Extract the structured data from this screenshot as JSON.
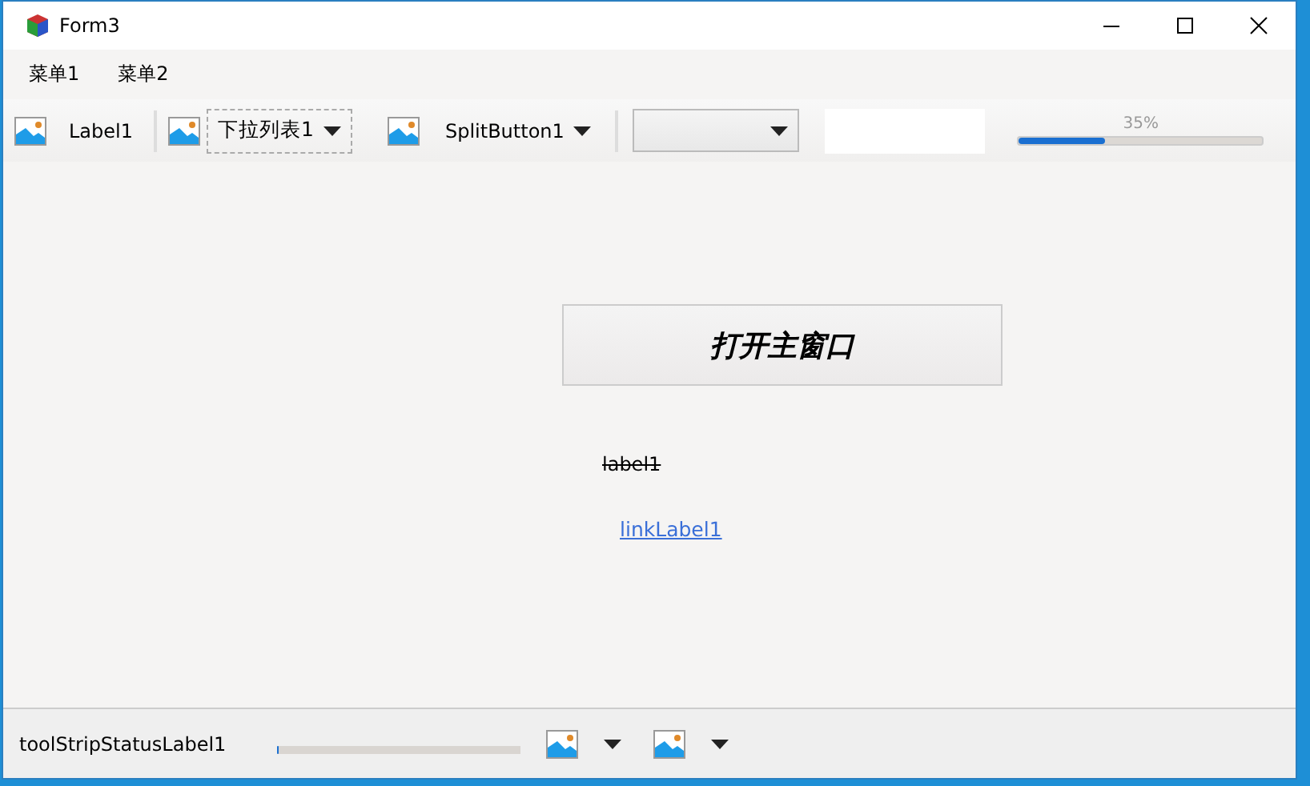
{
  "window": {
    "title": "Form3"
  },
  "menu": [
    {
      "label": "菜单1"
    },
    {
      "label": "菜单2"
    }
  ],
  "toolbar": [
    {
      "kind": "label",
      "text": "Label1"
    },
    {
      "kind": "separator"
    },
    {
      "kind": "dropdown",
      "text": "下拉列表1"
    },
    {
      "kind": "split",
      "text": "SplitButton1"
    },
    {
      "kind": "separator"
    },
    {
      "kind": "combobox"
    },
    {
      "kind": "textbox"
    },
    {
      "kind": "progress",
      "text": "35%",
      "level": 0.35
    }
  ],
  "content": {
    "button": "打开主窗口",
    "label": "label1",
    "link": "linkLabel1"
  },
  "status_bar": [
    {
      "kind": "label",
      "text": "toolStripStatusLabel1"
    },
    {
      "kind": "progress",
      "level": 0
    },
    {
      "kind": "dropdown"
    },
    {
      "kind": "dropdown"
    }
  ]
}
